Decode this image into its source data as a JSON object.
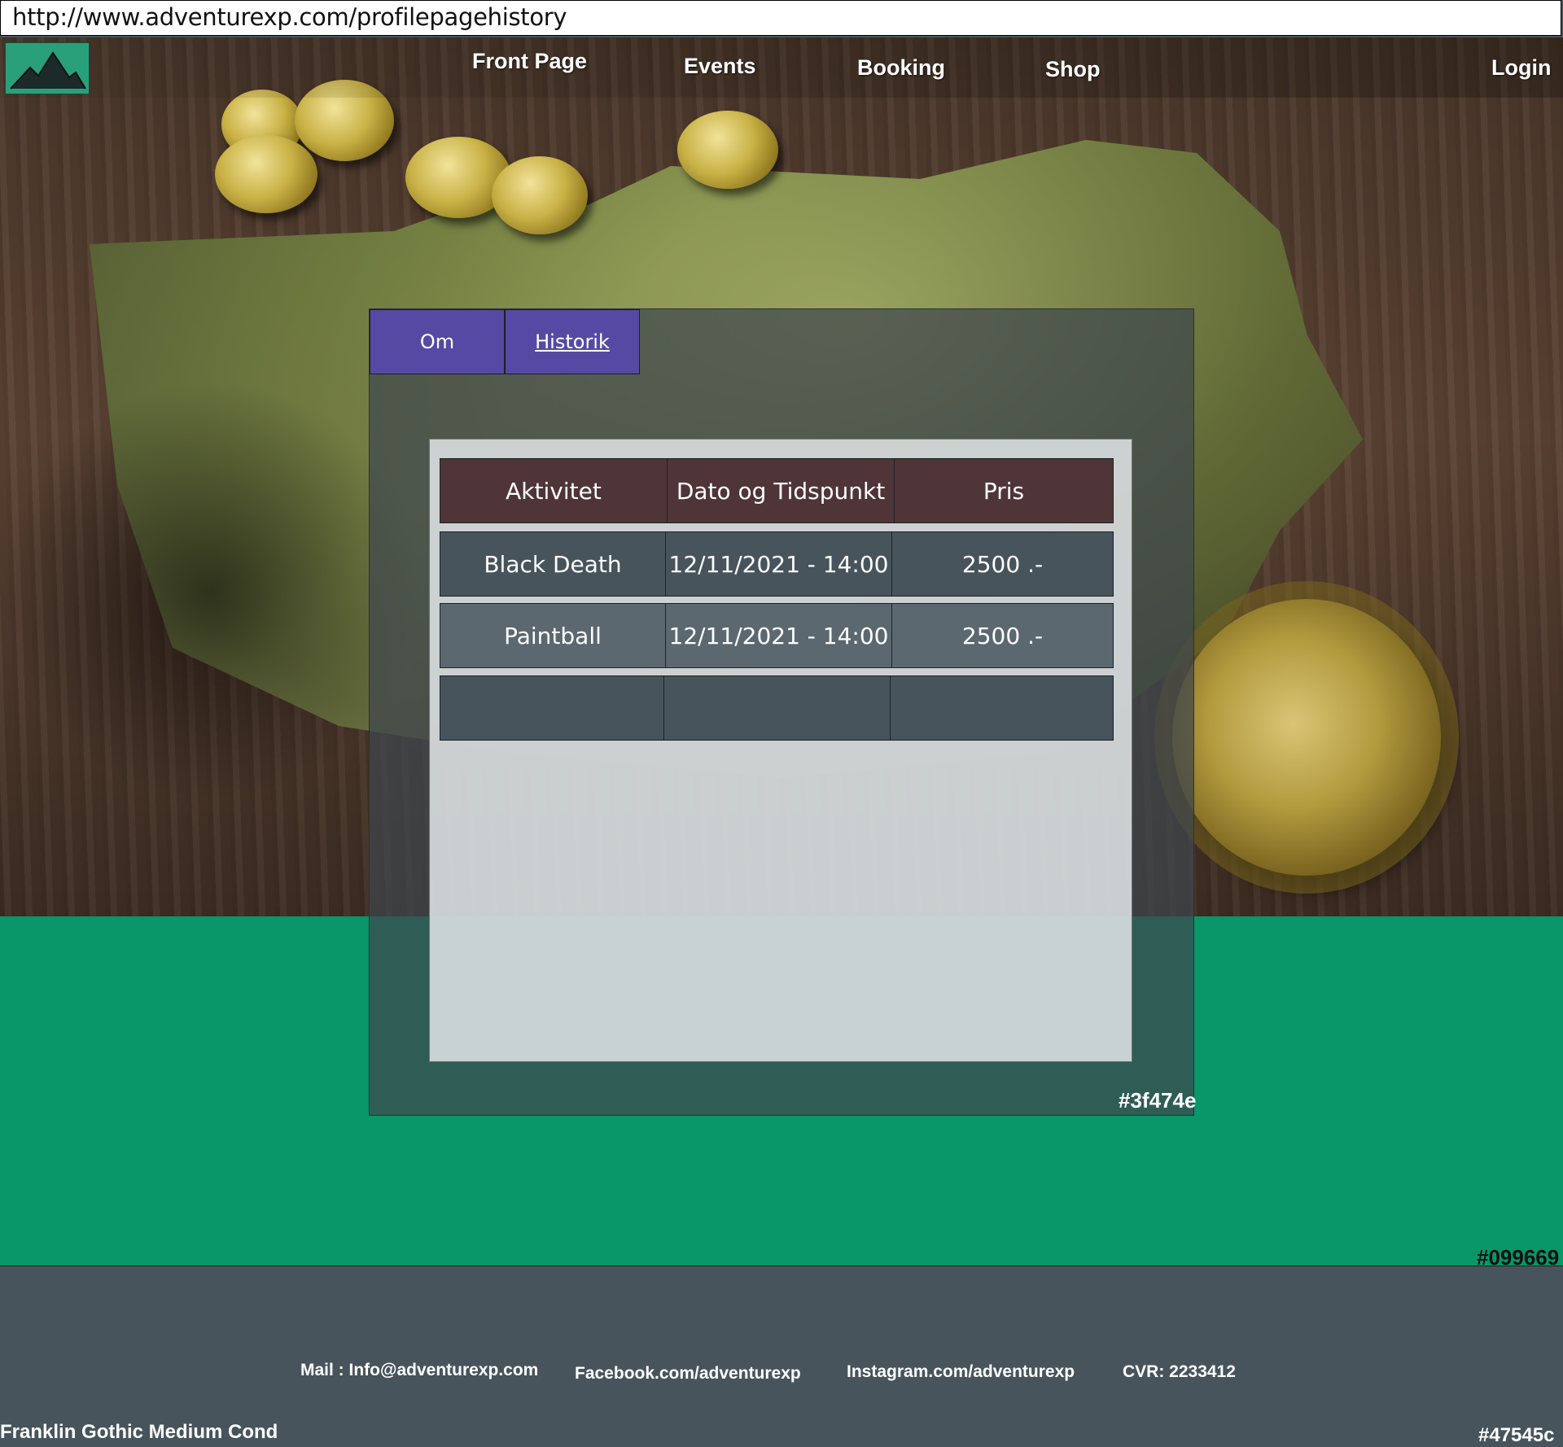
{
  "browser": {
    "url": "http://www.adventurexp.com/profilepagehistory"
  },
  "nav": {
    "items": [
      "Front Page",
      "Events",
      "Booking",
      "Shop"
    ],
    "login": "Login"
  },
  "profile": {
    "tabs": [
      {
        "label": "Om",
        "active": false
      },
      {
        "label": "Historik",
        "active": true
      }
    ],
    "history_table": {
      "columns": [
        "Aktivitet",
        "Dato og Tidspunkt",
        "Pris"
      ],
      "rows": [
        [
          "Black Death",
          "12/11/2021 - 14:00",
          "2500 .-"
        ],
        [
          "Paintball",
          "12/11/2021 - 14:00",
          "2500 .-"
        ],
        [
          "",
          "",
          ""
        ]
      ]
    }
  },
  "footer": {
    "mail": "Mail : Info@adventurexp.com",
    "facebook": "Facebook.com/adventurexp",
    "instagram": "Instagram.com/adventurexp",
    "cvr": "CVR: 2233412"
  },
  "annotations": {
    "panel_color": "#3f474e",
    "green_color": "#099669",
    "footer_color": "#47545c",
    "font_note": "Franklin Gothic Medium Cond"
  },
  "colors": {
    "tab": "#5649a3",
    "table_header": "#4f3538",
    "row_dark": "#47545c",
    "row_light": "#5b6870",
    "green_band": "#099669",
    "footer": "#47545c",
    "logo_bg": "#2aa07a"
  }
}
